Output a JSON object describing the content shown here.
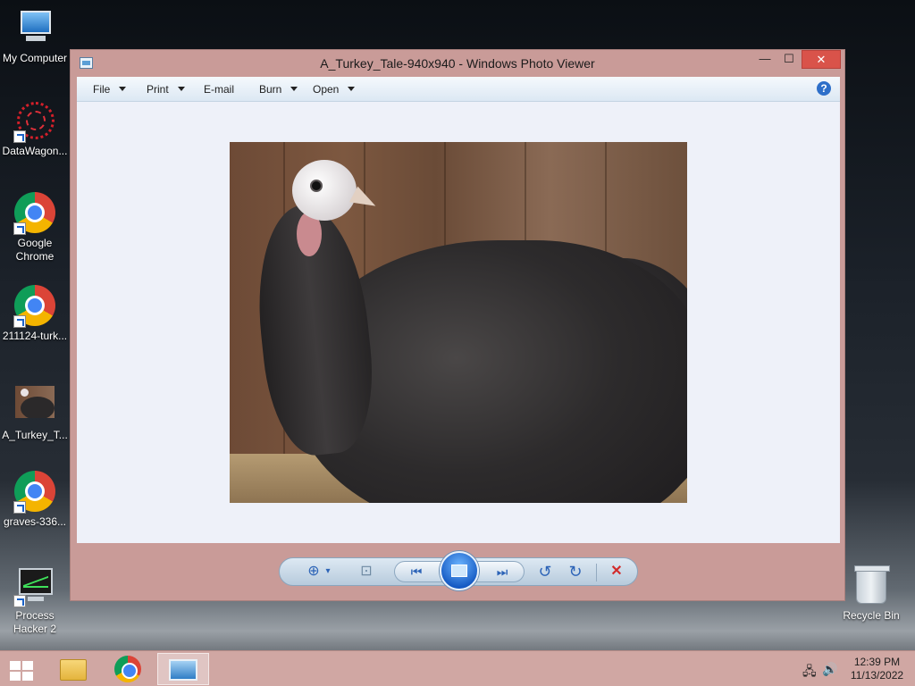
{
  "desktop": {
    "icons": [
      {
        "label": "My Computer",
        "icon": "computer-icon"
      },
      {
        "label": "DataWagon...",
        "icon": "datawagon-icon"
      },
      {
        "label": "Google Chrome",
        "icon": "chrome-icon"
      },
      {
        "label": "211124-turk...",
        "icon": "chrome-icon"
      },
      {
        "label": "A_Turkey_T...",
        "icon": "image-thumbnail-icon"
      },
      {
        "label": "graves-336...",
        "icon": "chrome-icon"
      },
      {
        "label": "Process Hacker 2",
        "icon": "process-hacker-icon"
      },
      {
        "label": "Recycle Bin",
        "icon": "recycle-bin-icon"
      }
    ]
  },
  "window": {
    "title": "A_Turkey_Tale-940x940 - Windows Photo Viewer",
    "controls": {
      "minimize": "—",
      "maximize": "☐",
      "close": "✕"
    },
    "menu": [
      {
        "label": "File",
        "has_dropdown": true
      },
      {
        "label": "Print",
        "has_dropdown": true
      },
      {
        "label": "E-mail",
        "has_dropdown": false
      },
      {
        "label": "Burn",
        "has_dropdown": true
      },
      {
        "label": "Open",
        "has_dropdown": true
      }
    ],
    "help": "?",
    "toolbar": {
      "zoom": "⊕",
      "zoom_dropdown": "▾",
      "actual_size": "⊡",
      "previous": "⏮",
      "next": "⏭",
      "rotate_ccw": "↺",
      "rotate_cw": "↻",
      "delete": "✕"
    }
  },
  "taskbar": {
    "time": "12:39 PM",
    "date": "11/13/2022",
    "network": "🖧",
    "volume": "🔊"
  },
  "colors": {
    "window_frame": "#c99b98",
    "taskbar": "#d0a7a3",
    "close_button": "#d9534a",
    "accent_blue": "#2c63b7"
  }
}
